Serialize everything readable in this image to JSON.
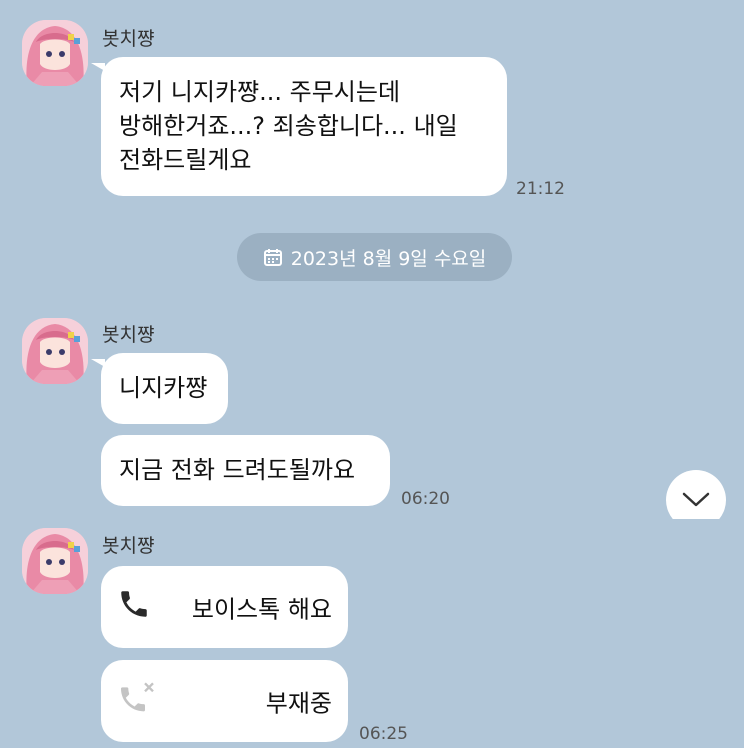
{
  "sender_name": "봇치쨩",
  "date_divider": "2023년 8월 9일 수요일",
  "groups": [
    {
      "messages": [
        "저기 니지카쨩... 주무시는데",
        "방해한거죠...? 죄송합니다... 내일",
        "전화드릴게요"
      ],
      "time": "21:12"
    },
    {
      "messages": [
        "니지카쨩",
        "지금 전화 드려도될까요"
      ],
      "time": "06:20"
    },
    {
      "calls": [
        {
          "icon": "phone-icon",
          "label": "보이스톡 해요"
        },
        {
          "icon": "missed-call-icon",
          "label": "부재중"
        }
      ],
      "time": "06:25"
    }
  ]
}
